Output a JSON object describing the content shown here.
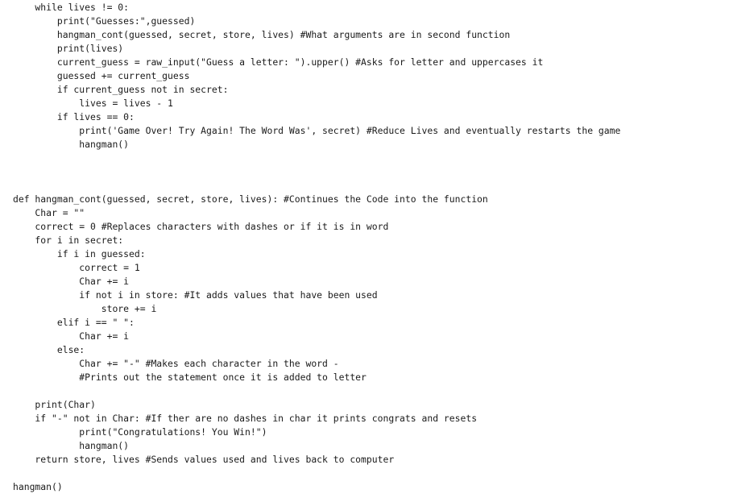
{
  "code": {
    "lines": [
      "    while lives != 0:",
      "        print(\"Guesses:\",guessed)",
      "        hangman_cont(guessed, secret, store, lives) #What arguments are in second function",
      "        print(lives)",
      "        current_guess = raw_input(\"Guess a letter: \").upper() #Asks for letter and uppercases it",
      "        guessed += current_guess",
      "        if current_guess not in secret:",
      "            lives = lives - 1",
      "        if lives == 0:",
      "            print('Game Over! Try Again! The Word Was', secret) #Reduce Lives and eventually restarts the game",
      "            hangman()",
      "",
      "",
      "",
      "def hangman_cont(guessed, secret, store, lives): #Continues the Code into the function",
      "    Char = \"\"",
      "    correct = 0 #Replaces characters with dashes or if it is in word",
      "    for i in secret:",
      "        if i in guessed:",
      "            correct = 1",
      "            Char += i",
      "            if not i in store: #It adds values that have been used",
      "                store += i",
      "        elif i == \" \":",
      "            Char += i",
      "        else:",
      "            Char += \"-\" #Makes each character in the word -",
      "            #Prints out the statement once it is added to letter",
      "",
      "    print(Char)",
      "    if \"-\" not in Char: #If ther are no dashes in char it prints congrats and resets",
      "            print(\"Congratulations! You Win!\")",
      "            hangman()",
      "    return store, lives #Sends values used and lives back to computer",
      "",
      "hangman()"
    ]
  }
}
